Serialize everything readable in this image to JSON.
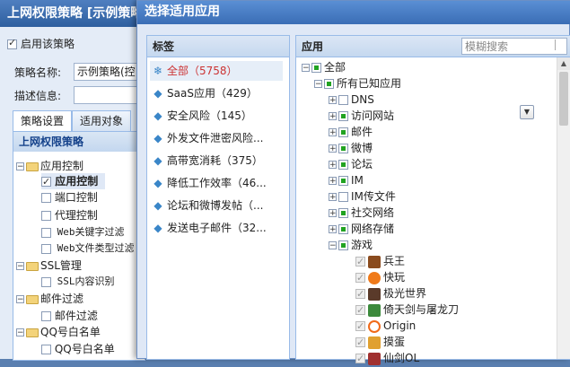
{
  "bg": {
    "title": "上网权限策略 [示例策略]",
    "enable_label": "启用该策略",
    "name_label": "策略名称:",
    "name_value": "示例策略(控",
    "desc_label": "描述信息:",
    "tabs": [
      "策略设置",
      "适用对象"
    ],
    "tree_title": "上网权限策略",
    "tree": [
      {
        "label": "应用控制"
      },
      {
        "label": "应用控制"
      },
      {
        "label": "端口控制"
      },
      {
        "label": "代理控制"
      },
      {
        "label": "Web关键字过滤"
      },
      {
        "label": "Web文件类型过滤"
      },
      {
        "label": "SSL管理"
      },
      {
        "label": "SSL内容识别"
      },
      {
        "label": "邮件过滤"
      },
      {
        "label": "邮件过滤"
      },
      {
        "label": "QQ号白名单"
      },
      {
        "label": "QQ号白名单"
      }
    ]
  },
  "modal": {
    "title": "选择适用应用",
    "tags_header": "标签",
    "tags": [
      {
        "label": "全部（5758）",
        "icon": "snowflake-icon"
      },
      {
        "label": "SaaS应用（429）",
        "icon": "tag-icon"
      },
      {
        "label": "安全风险（145）",
        "icon": "tag-icon"
      },
      {
        "label": "外发文件泄密风险...",
        "icon": "tag-icon"
      },
      {
        "label": "高带宽消耗（375）",
        "icon": "tag-icon"
      },
      {
        "label": "降低工作效率（46...",
        "icon": "tag-icon"
      },
      {
        "label": "论坛和微博发帖（...",
        "icon": "tag-icon"
      },
      {
        "label": "发送电子邮件（32...",
        "icon": "tag-icon"
      }
    ],
    "apps_header": "应用",
    "search_placeholder": "模糊搜索",
    "apps": [
      {
        "label": "全部"
      },
      {
        "label": "所有已知应用"
      },
      {
        "label": "DNS"
      },
      {
        "label": "访问网站"
      },
      {
        "label": "邮件"
      },
      {
        "label": "微博"
      },
      {
        "label": "论坛"
      },
      {
        "label": "IM"
      },
      {
        "label": "IM传文件"
      },
      {
        "label": "社交网络"
      },
      {
        "label": "网络存储"
      },
      {
        "label": "游戏"
      },
      {
        "label": "兵王"
      },
      {
        "label": "快玩"
      },
      {
        "label": "极光世界"
      },
      {
        "label": "倚天剑与屠龙刀"
      },
      {
        "label": "Origin"
      },
      {
        "label": "摸蛋"
      },
      {
        "label": "仙剑OL"
      }
    ]
  },
  "colors": {
    "title_bar": "#3a6db5",
    "selected_tag": "#cc3333",
    "check_green": "#21a321"
  }
}
